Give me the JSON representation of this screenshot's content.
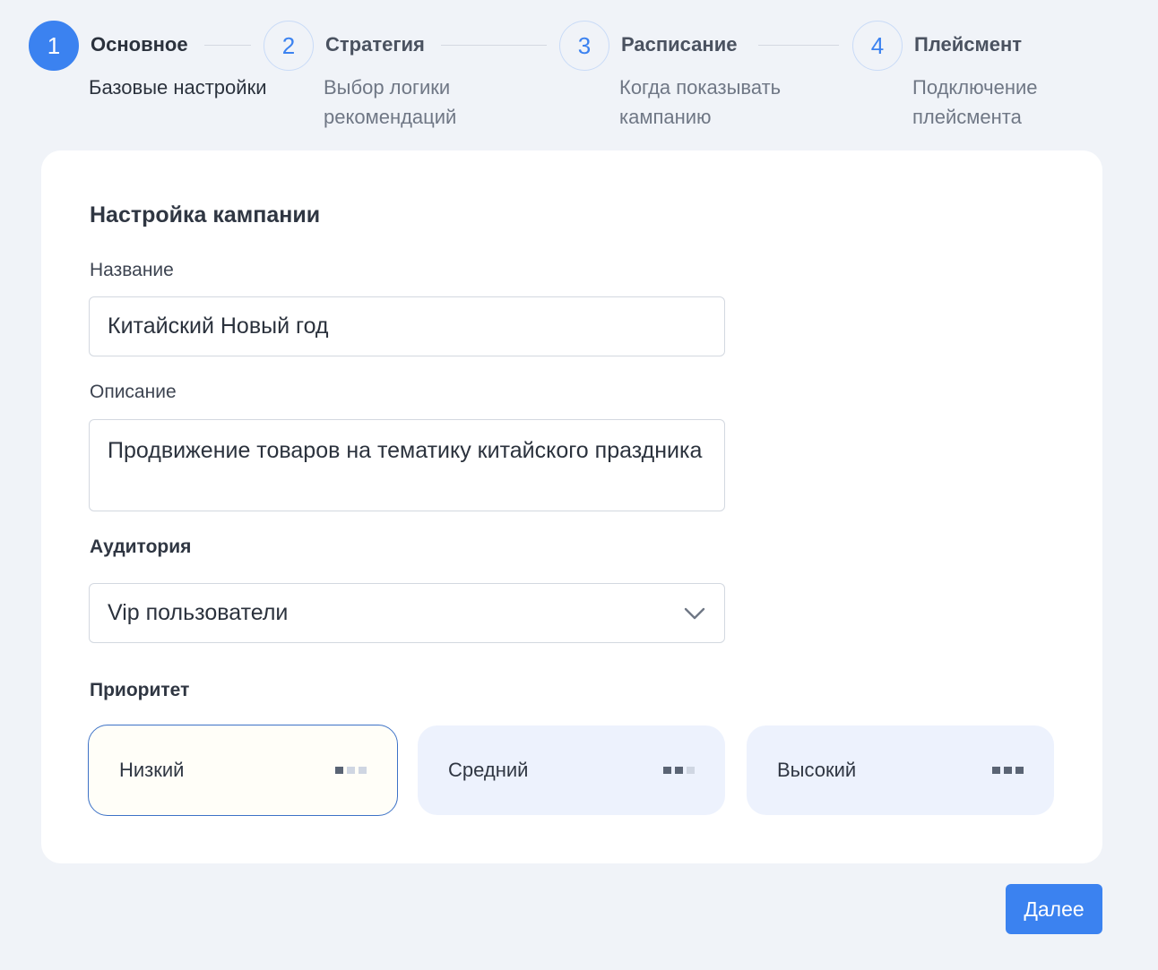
{
  "stepper": {
    "steps": [
      {
        "number": "1",
        "title": "Основное",
        "subtitle": "Базовые настройки"
      },
      {
        "number": "2",
        "title": "Стратегия",
        "subtitle": "Выбор логики рекомендаций"
      },
      {
        "number": "3",
        "title": "Расписание",
        "subtitle": "Когда показывать кампанию"
      },
      {
        "number": "4",
        "title": "Плейсмент",
        "subtitle": "Подключение плейсмента"
      }
    ],
    "active_step": 1
  },
  "form": {
    "heading": "Настройка кампании",
    "name_label": "Название",
    "name_value": "Китайский Новый год",
    "description_label": "Описание",
    "description_value": "Продвижение товаров на тематику китайского праздника",
    "audience_label": "Аудитория",
    "audience_value": "Vip пользователи",
    "priority_label": "Приоритет",
    "priority_options": [
      {
        "label": "Низкий",
        "level": 1
      },
      {
        "label": "Средний",
        "level": 2
      },
      {
        "label": "Высокий",
        "level": 3
      }
    ],
    "priority_selected": "Низкий"
  },
  "footer": {
    "next_label": "Далее"
  },
  "colors": {
    "accent": "#3b82f0",
    "background": "#f0f3f8",
    "selected_border": "#3d72c7"
  }
}
